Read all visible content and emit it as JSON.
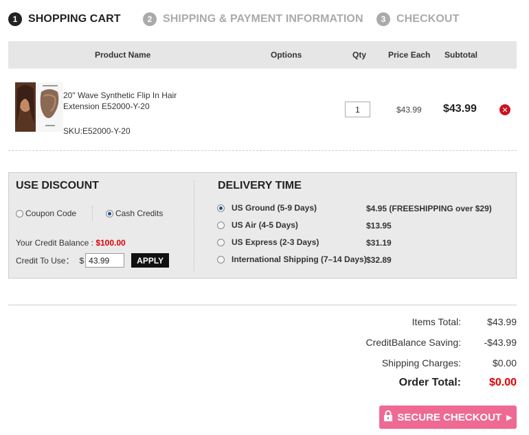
{
  "steps": [
    {
      "num": "1",
      "label": "SHOPPING CART"
    },
    {
      "num": "2",
      "label": "SHIPPING & PAYMENT INFORMATION"
    },
    {
      "num": "3",
      "label": "CHECKOUT"
    }
  ],
  "cart_header": {
    "product_name": "Product Name",
    "options": "Options",
    "qty": "Qty",
    "price_each": "Price Each",
    "subtotal": "Subtotal"
  },
  "item": {
    "name": "20\" Wave Synthetic Flip In Hair Extension E52000-Y-20",
    "sku": "SKU:E52000-Y-20",
    "qty": "1",
    "price_each": "$43.99",
    "subtotal": "$43.99"
  },
  "discount": {
    "title": "USE DISCOUNT",
    "coupon_label": "Coupon Code",
    "cash_label": "Cash Credits",
    "selected": "cash",
    "balance_label": "Your Credit Balance :",
    "balance_value": "$100.00",
    "credit_use_label": "Credit To Use：",
    "currency": "$",
    "credit_use_value": "43.99",
    "apply_label": "APPLY"
  },
  "delivery": {
    "title": "DELIVERY TIME",
    "options": [
      {
        "label": "US Ground (5-9 Days)",
        "price": "$4.95 (FREESHIPPING over $29)",
        "checked": true
      },
      {
        "label": "US Air (4-5 Days)",
        "price": "$13.95",
        "checked": false
      },
      {
        "label": "US Express (2-3 Days)",
        "price": "$31.19",
        "checked": false
      },
      {
        "label": "International Shipping (7–14 Days)",
        "price": "$32.89",
        "checked": false
      }
    ]
  },
  "totals": {
    "items_total_label": "Items Total:",
    "items_total_value": "$43.99",
    "credit_saving_label": "CreditBalance Saving:",
    "credit_saving_value": "-$43.99",
    "shipping_label": "Shipping Charges:",
    "shipping_value": "$0.00",
    "order_total_label": "Order Total:",
    "order_total_value": "$0.00"
  },
  "checkout_button": {
    "label": "SECURE CHECKOUT",
    "color": "#ee6a93",
    "icon": "lock-icon"
  },
  "colors": {
    "accent_red": "#dd0000",
    "header_bg": "#e6e6e6"
  }
}
